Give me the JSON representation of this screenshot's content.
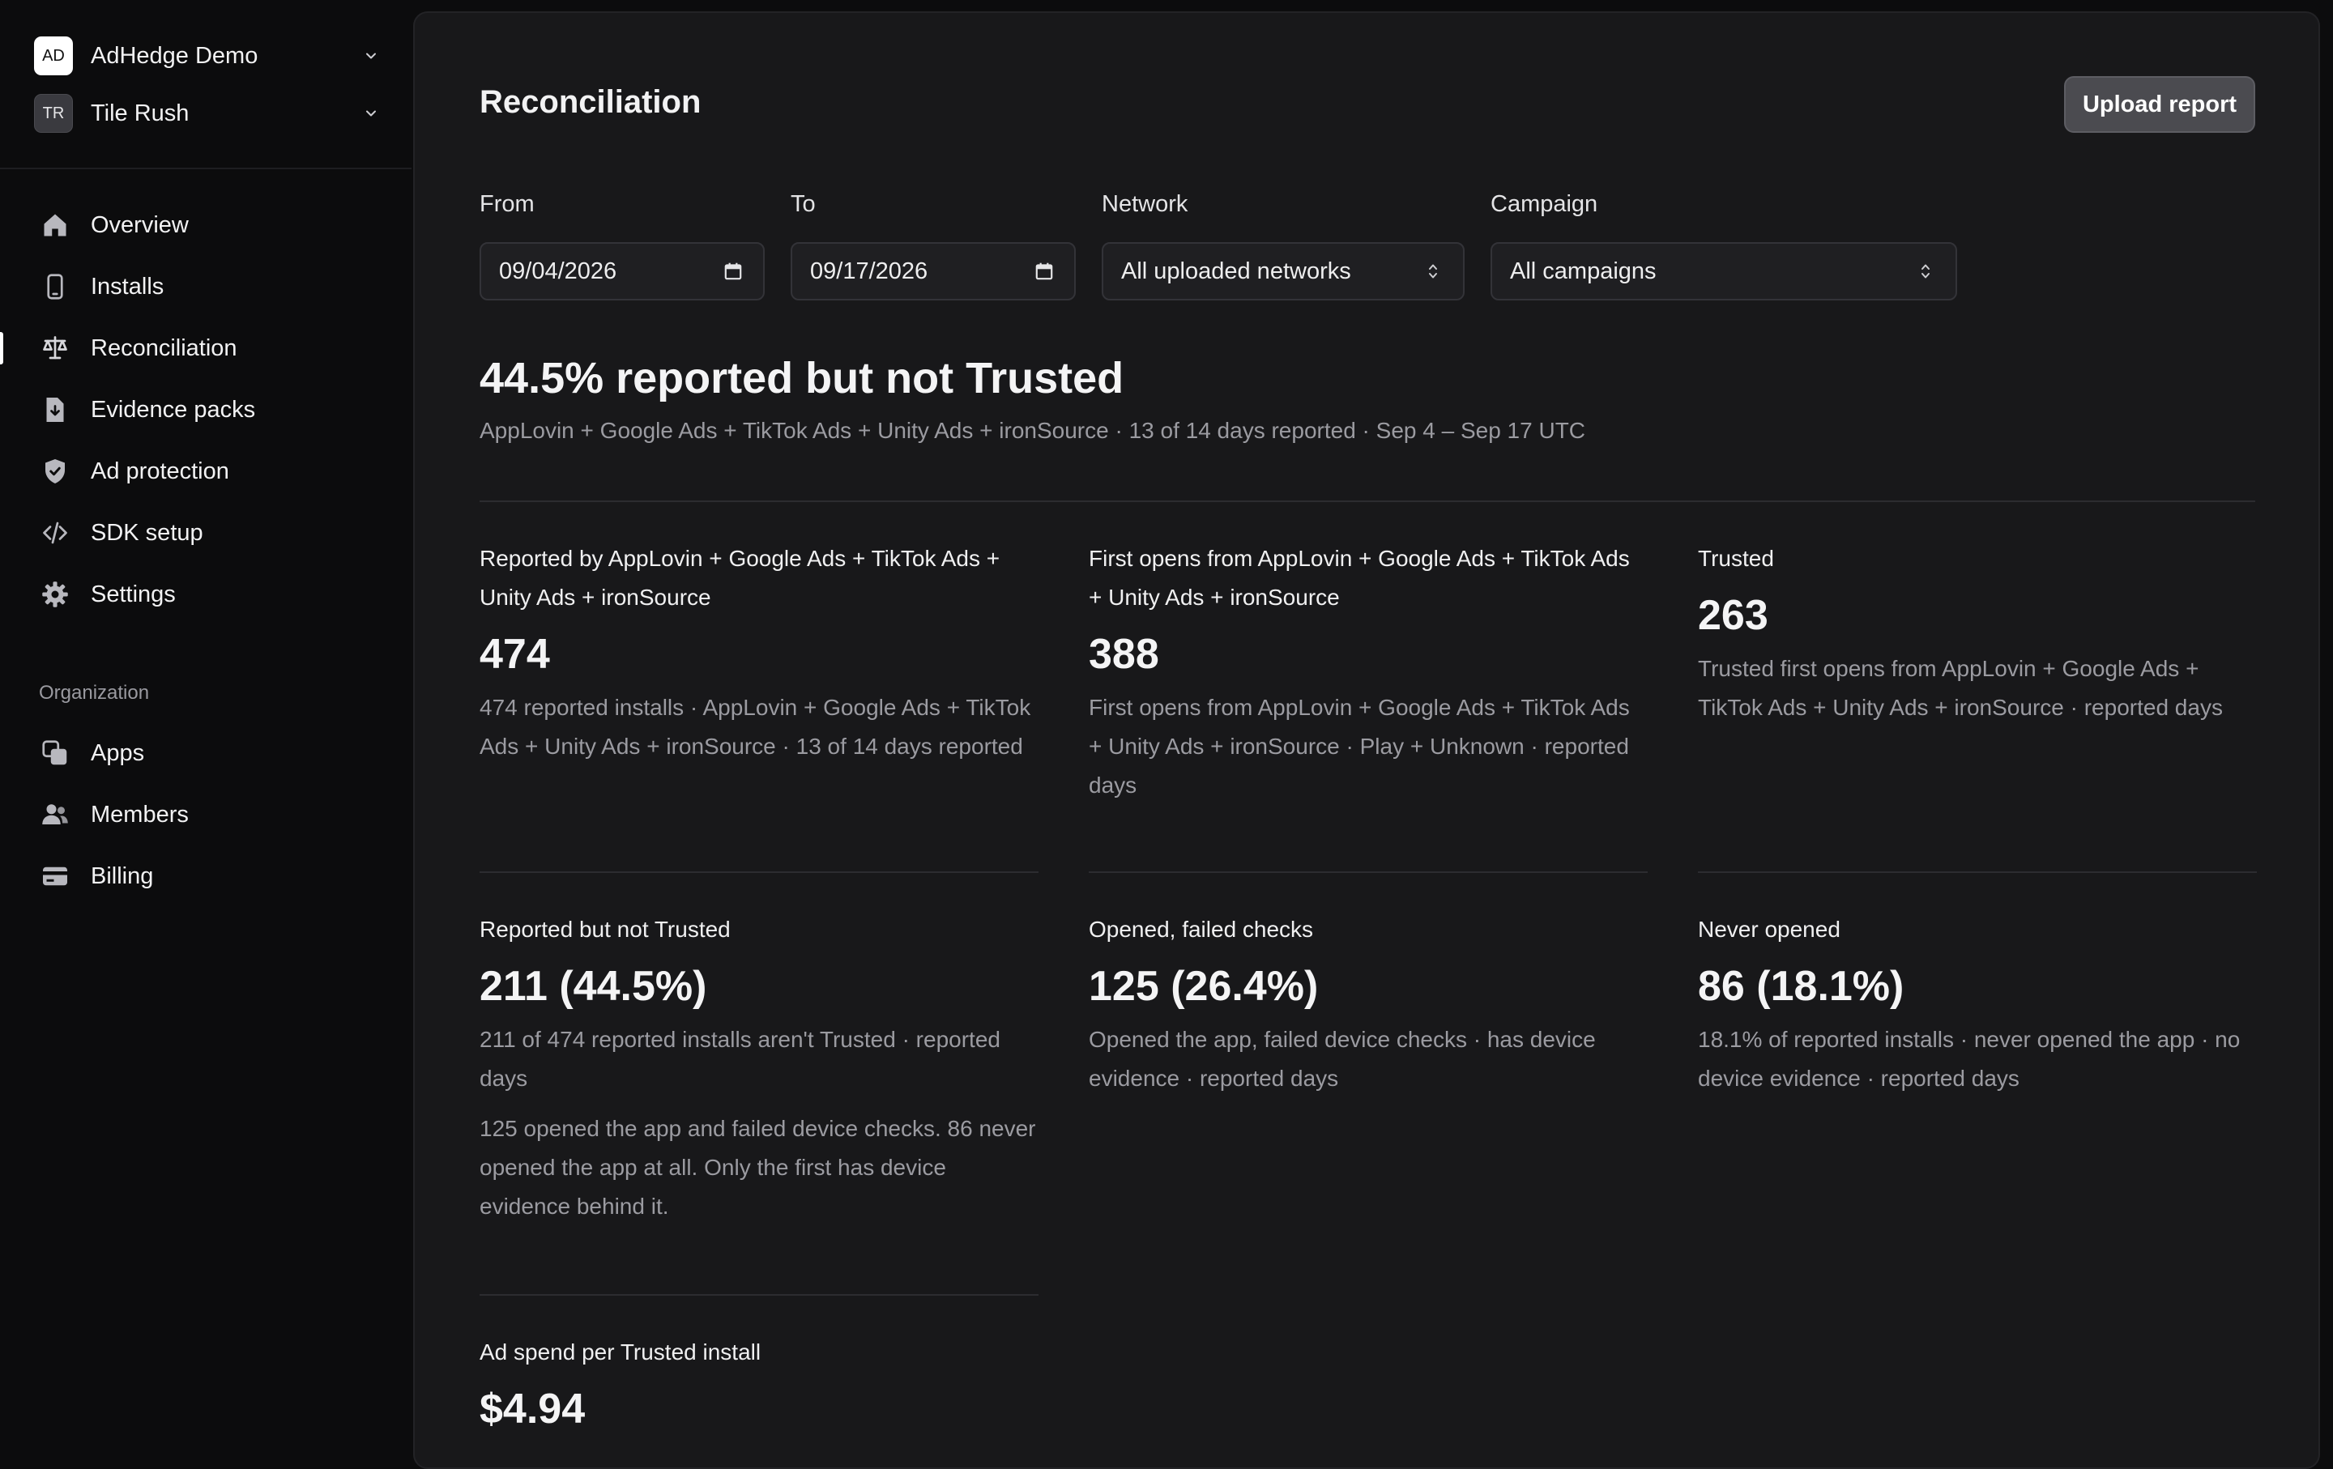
{
  "org_switcher": {
    "badge": "AD",
    "name": "AdHedge Demo",
    "chevron_icon": "chevron-down-icon"
  },
  "app_switcher": {
    "badge": "TR",
    "name": "Tile Rush",
    "chevron_icon": "chevron-down-icon"
  },
  "sidebar": {
    "items": [
      {
        "label": "Overview",
        "icon": "home-icon"
      },
      {
        "label": "Installs",
        "icon": "phone-icon"
      },
      {
        "label": "Reconciliation",
        "icon": "scale-icon",
        "active": true
      },
      {
        "label": "Evidence packs",
        "icon": "file-download-icon"
      },
      {
        "label": "Ad protection",
        "icon": "shield-check-icon"
      },
      {
        "label": "SDK setup",
        "icon": "code-icon"
      },
      {
        "label": "Settings",
        "icon": "gear-icon"
      }
    ],
    "section_label": "Organization",
    "org_items": [
      {
        "label": "Apps",
        "icon": "apps-icon"
      },
      {
        "label": "Members",
        "icon": "users-icon"
      },
      {
        "label": "Billing",
        "icon": "credit-card-icon"
      }
    ]
  },
  "page": {
    "title": "Reconciliation",
    "upload_button": "Upload report"
  },
  "filters": {
    "from": {
      "label": "From",
      "value": "09/04/2026",
      "icon": "calendar-icon"
    },
    "to": {
      "label": "To",
      "value": "09/17/2026",
      "icon": "calendar-icon"
    },
    "network": {
      "label": "Network",
      "value": "All uploaded networks",
      "icon": "select-arrows-icon"
    },
    "campaign": {
      "label": "Campaign",
      "value": "All campaigns",
      "icon": "select-arrows-icon"
    }
  },
  "summary": {
    "headline": "44.5% reported but not Trusted",
    "subline": "AppLovin + Google Ads + TikTok Ads + Unity Ads + ironSource · 13 of 14 days reported · Sep 4 – Sep 17 UTC"
  },
  "cards": {
    "reported": {
      "title": "Reported by AppLovin + Google Ads + TikTok Ads + Unity Ads + ironSource",
      "value": "474",
      "desc": "474 reported installs · AppLovin + Google Ads + TikTok Ads + Unity Ads + ironSource · 13 of 14 days reported"
    },
    "first_opens": {
      "title": "First opens from AppLovin + Google Ads + TikTok Ads + Unity Ads + ironSource",
      "value": "388",
      "desc": "First opens from AppLovin + Google Ads + TikTok Ads + Unity Ads + ironSource · Play + Unknown · reported days"
    },
    "trusted": {
      "title": "Trusted",
      "value": "263",
      "desc": "Trusted first opens from AppLovin + Google Ads + TikTok Ads + Unity Ads + ironSource · reported days"
    },
    "not_trusted": {
      "title": "Reported but not Trusted",
      "value": "211 (44.5%)",
      "desc": "211 of 474 reported installs aren't Trusted · reported days",
      "note": "125 opened the app and failed device checks. 86 never opened the app at all. Only the first has device evidence behind it."
    },
    "failed_checks": {
      "title": "Opened, failed checks",
      "value": "125 (26.4%)",
      "desc": "Opened the app, failed device checks · has device evidence · reported days"
    },
    "never_opened": {
      "title": "Never opened",
      "value": "86 (18.1%)",
      "desc": "18.1% of reported installs · never opened the app · no device evidence · reported days"
    },
    "ad_spend": {
      "title": "Ad spend per Trusted install",
      "value": "$4.94"
    }
  }
}
